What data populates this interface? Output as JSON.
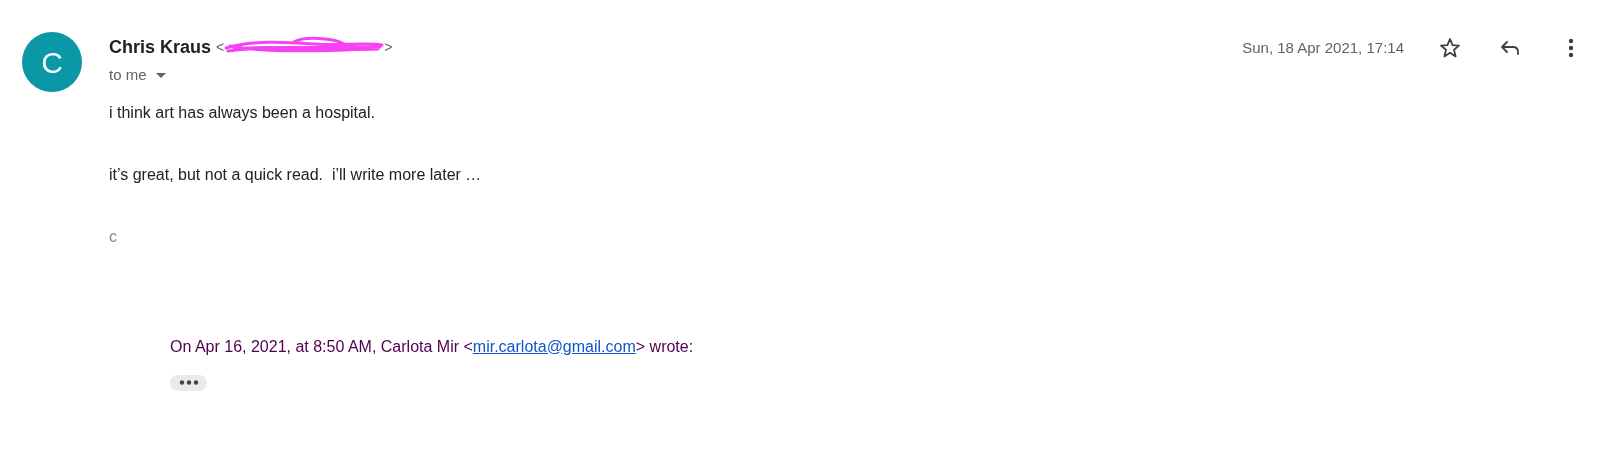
{
  "sender": {
    "initial": "C",
    "name": "Chris Kraus",
    "email_open": "<",
    "email_close": ">",
    "redacted": true,
    "recipient": "to me"
  },
  "date": "Sun, 18 Apr 2021, 17:14",
  "body": [
    "i think art has always been a hospital.",
    "it’s great, but not a quick read.  i’ll write more later …"
  ],
  "signature": "c",
  "quote": {
    "prefix": "On Apr 16, 2021, at 8:50 AM, Carlota Mir <",
    "link": "mir.carlota@gmail.com",
    "suffix": "> wrote:"
  }
}
